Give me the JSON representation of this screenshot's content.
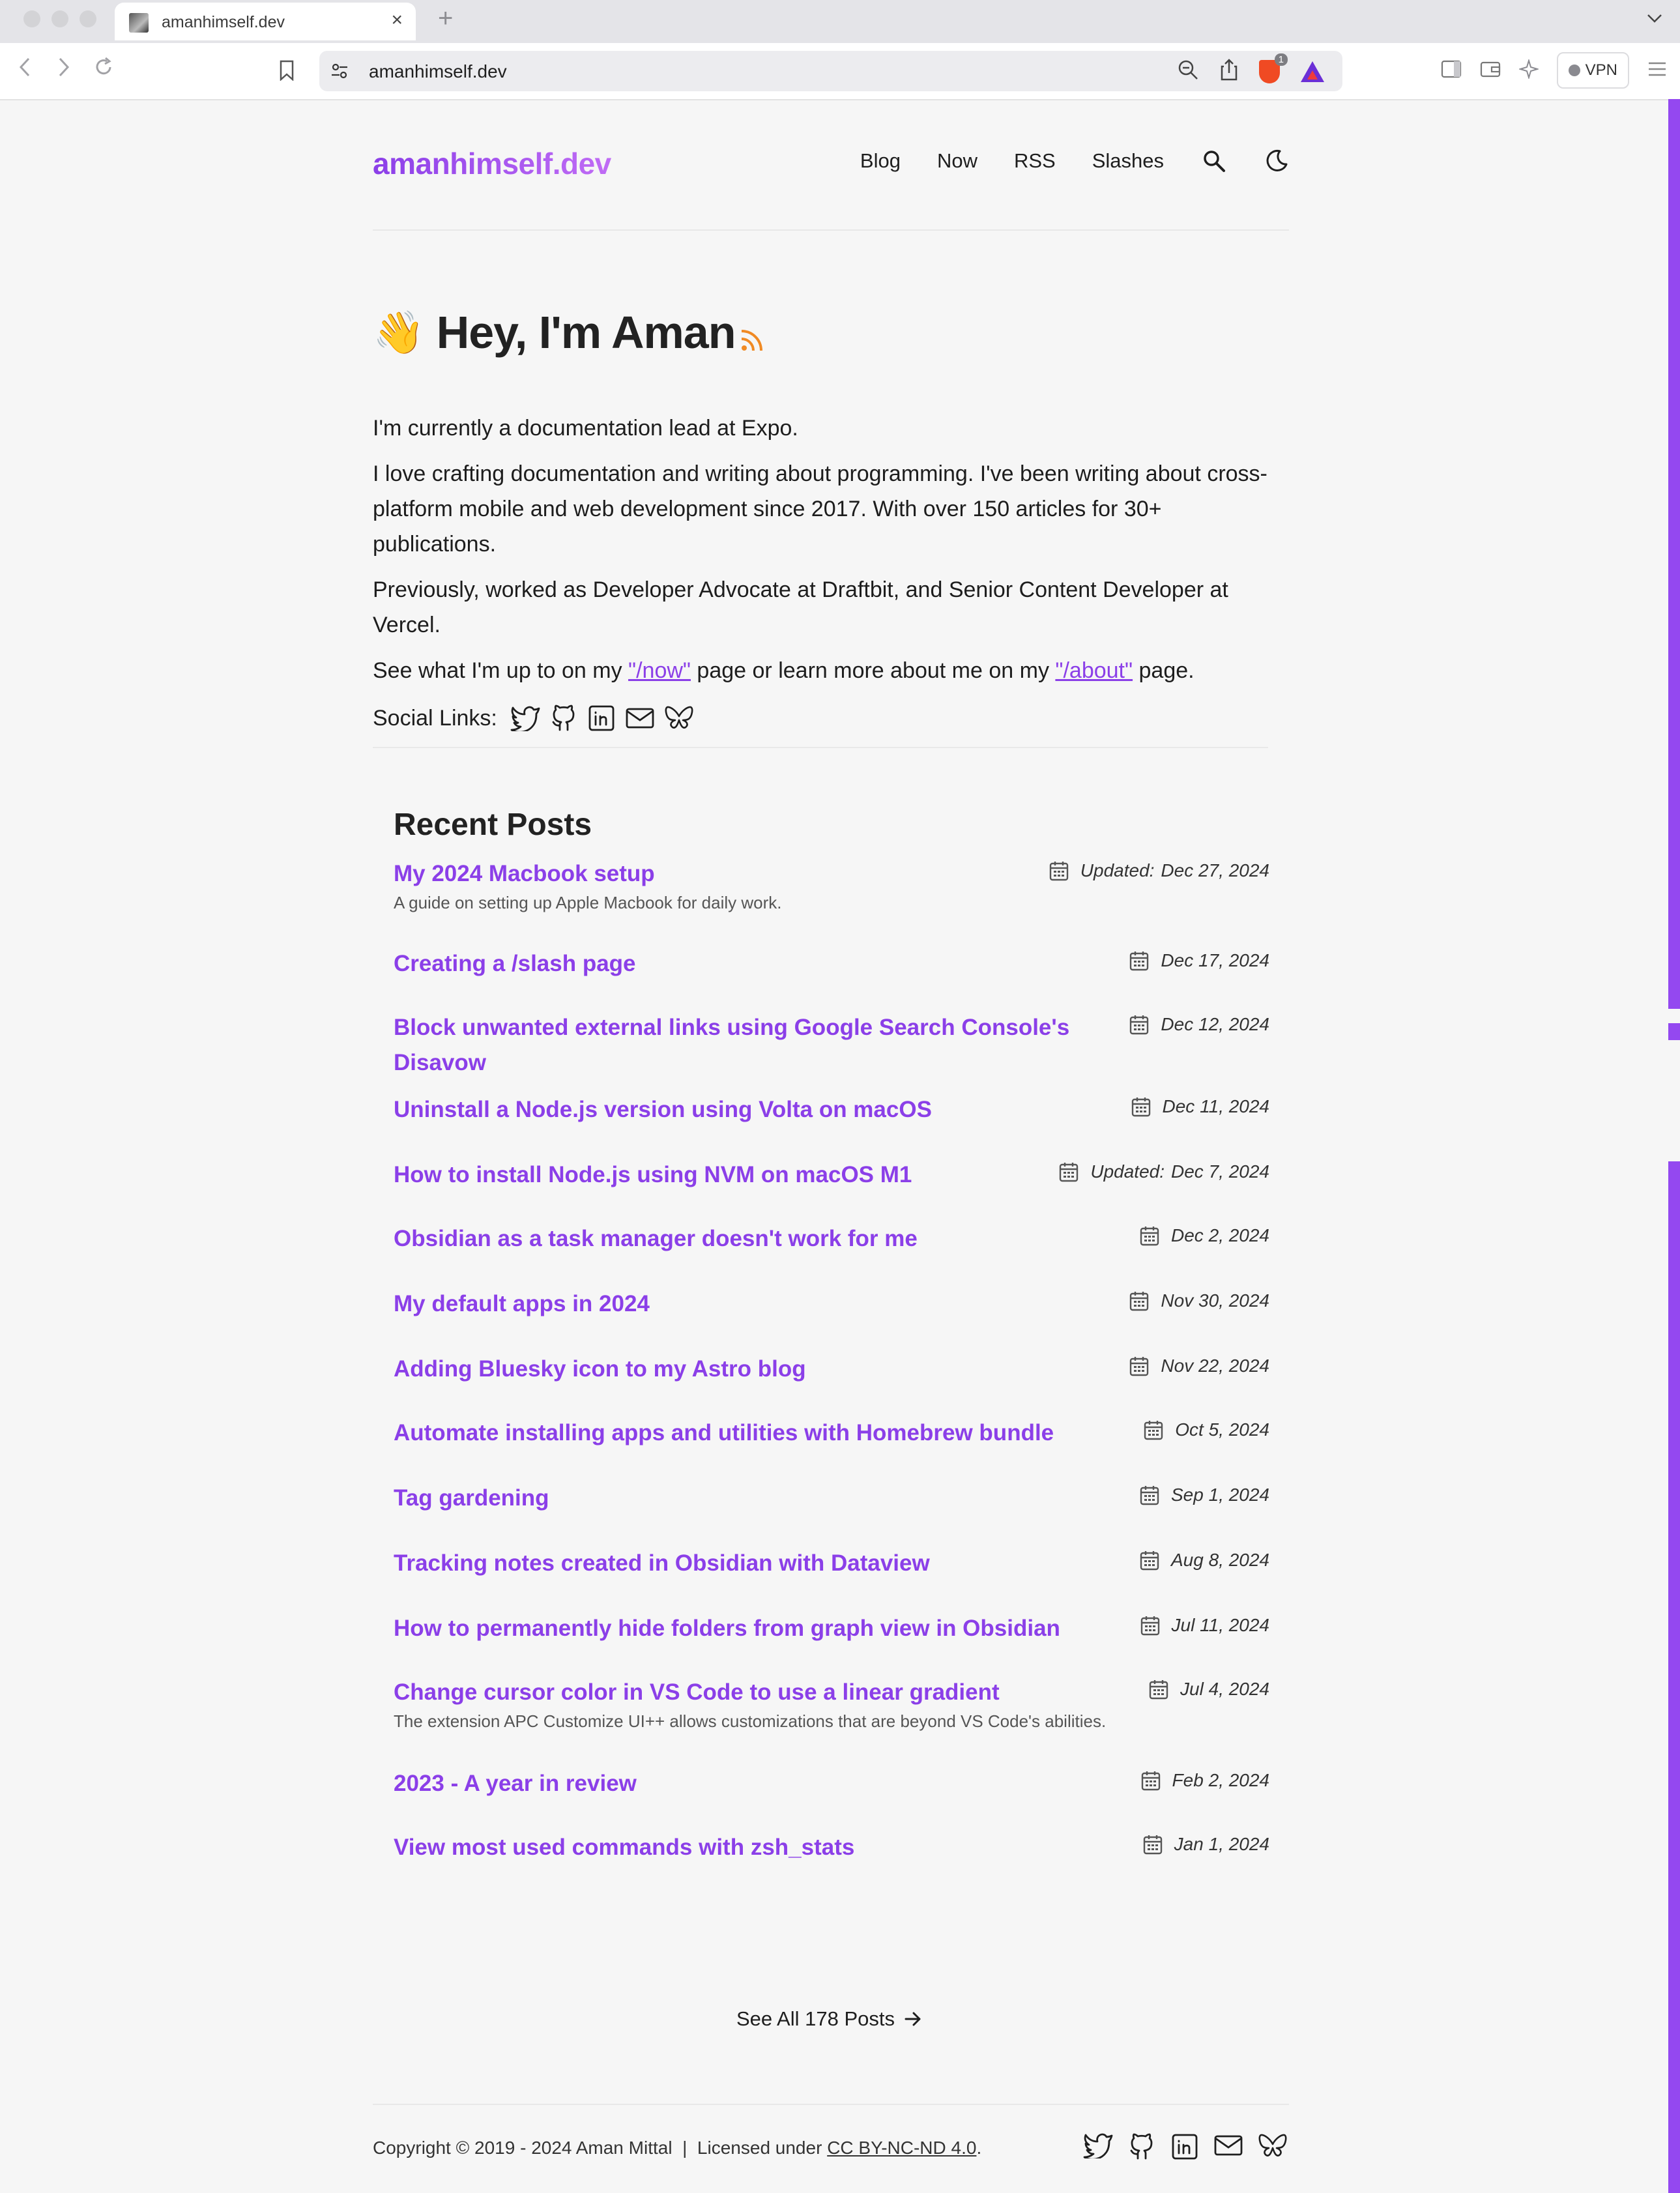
{
  "browser": {
    "tab_title": "amanhimself.dev",
    "url": "amanhimself.dev",
    "shields_count": "1",
    "vpn_label": "VPN"
  },
  "site": {
    "brand": "amanhimself.dev",
    "nav": [
      "Blog",
      "Now",
      "RSS",
      "Slashes"
    ]
  },
  "hero": {
    "wave": "👋",
    "title": "Hey, I'm Aman"
  },
  "intro": {
    "p1": "I'm currently a documentation lead at Expo.",
    "p2": "I love crafting documentation and writing about programming. I've been writing about cross-platform mobile and web development since 2017. With over 150 articles for 30+ publications.",
    "p3": "Previously, worked as Developer Advocate at Draftbit, and Senior Content Developer at Vercel.",
    "p4_before": "See what I'm up to on my ",
    "now_link": "\"/now\"",
    "p4_middle": " page or learn more about me on my ",
    "about_link": "\"/about\"",
    "p4_after": " page."
  },
  "social": {
    "label": "Social Links:",
    "icons": [
      "twitter-icon",
      "github-icon",
      "linkedin-icon",
      "mail-icon",
      "bluesky-icon"
    ]
  },
  "recent": {
    "heading": "Recent Posts",
    "updated_label": "Updated:",
    "posts": [
      {
        "title": "My 2024 Macbook setup",
        "date": "Dec 27, 2024",
        "updated": true,
        "desc": "A guide on setting up Apple Macbook for daily work."
      },
      {
        "title": "Creating a /slash page",
        "date": "Dec 17, 2024",
        "updated": false,
        "desc": ""
      },
      {
        "title": "Block unwanted external links using Google Search Console's Disavow",
        "date": "Dec 12, 2024",
        "updated": false,
        "desc": ""
      },
      {
        "title": "Uninstall a Node.js version using Volta on macOS",
        "date": "Dec 11, 2024",
        "updated": false,
        "desc": ""
      },
      {
        "title": "How to install Node.js using NVM on macOS M1",
        "date": "Dec 7, 2024",
        "updated": true,
        "desc": ""
      },
      {
        "title": "Obsidian as a task manager doesn't work for me",
        "date": "Dec 2, 2024",
        "updated": false,
        "desc": ""
      },
      {
        "title": "My default apps in 2024",
        "date": "Nov 30, 2024",
        "updated": false,
        "desc": ""
      },
      {
        "title": "Adding Bluesky icon to my Astro blog",
        "date": "Nov 22, 2024",
        "updated": false,
        "desc": ""
      },
      {
        "title": "Automate installing apps and utilities with Homebrew bundle",
        "date": "Oct 5, 2024",
        "updated": false,
        "desc": ""
      },
      {
        "title": "Tag gardening",
        "date": "Sep 1, 2024",
        "updated": false,
        "desc": ""
      },
      {
        "title": "Tracking notes created in Obsidian with Dataview",
        "date": "Aug 8, 2024",
        "updated": false,
        "desc": ""
      },
      {
        "title": "How to permanently hide folders from graph view in Obsidian",
        "date": "Jul 11, 2024",
        "updated": false,
        "desc": ""
      },
      {
        "title": "Change cursor color in VS Code to use a linear gradient",
        "date": "Jul 4, 2024",
        "updated": false,
        "desc": "The extension APC Customize UI++ allows customizations that are beyond VS Code's abilities."
      },
      {
        "title": "2023 - A year in review",
        "date": "Feb 2, 2024",
        "updated": false,
        "desc": ""
      },
      {
        "title": "View most used commands with zsh_stats",
        "date": "Jan 1, 2024",
        "updated": false,
        "desc": ""
      }
    ]
  },
  "see_all": "See All 178 Posts",
  "footer": {
    "copyright": "Copyright © 2019 - 2024 Aman Mittal  |  Licensed under ",
    "license": "CC BY-NC-ND 4.0",
    "end": "."
  },
  "colors": {
    "accent": "#8b3fe8",
    "background": "#f6f6f6",
    "rss": "#f08a24"
  }
}
